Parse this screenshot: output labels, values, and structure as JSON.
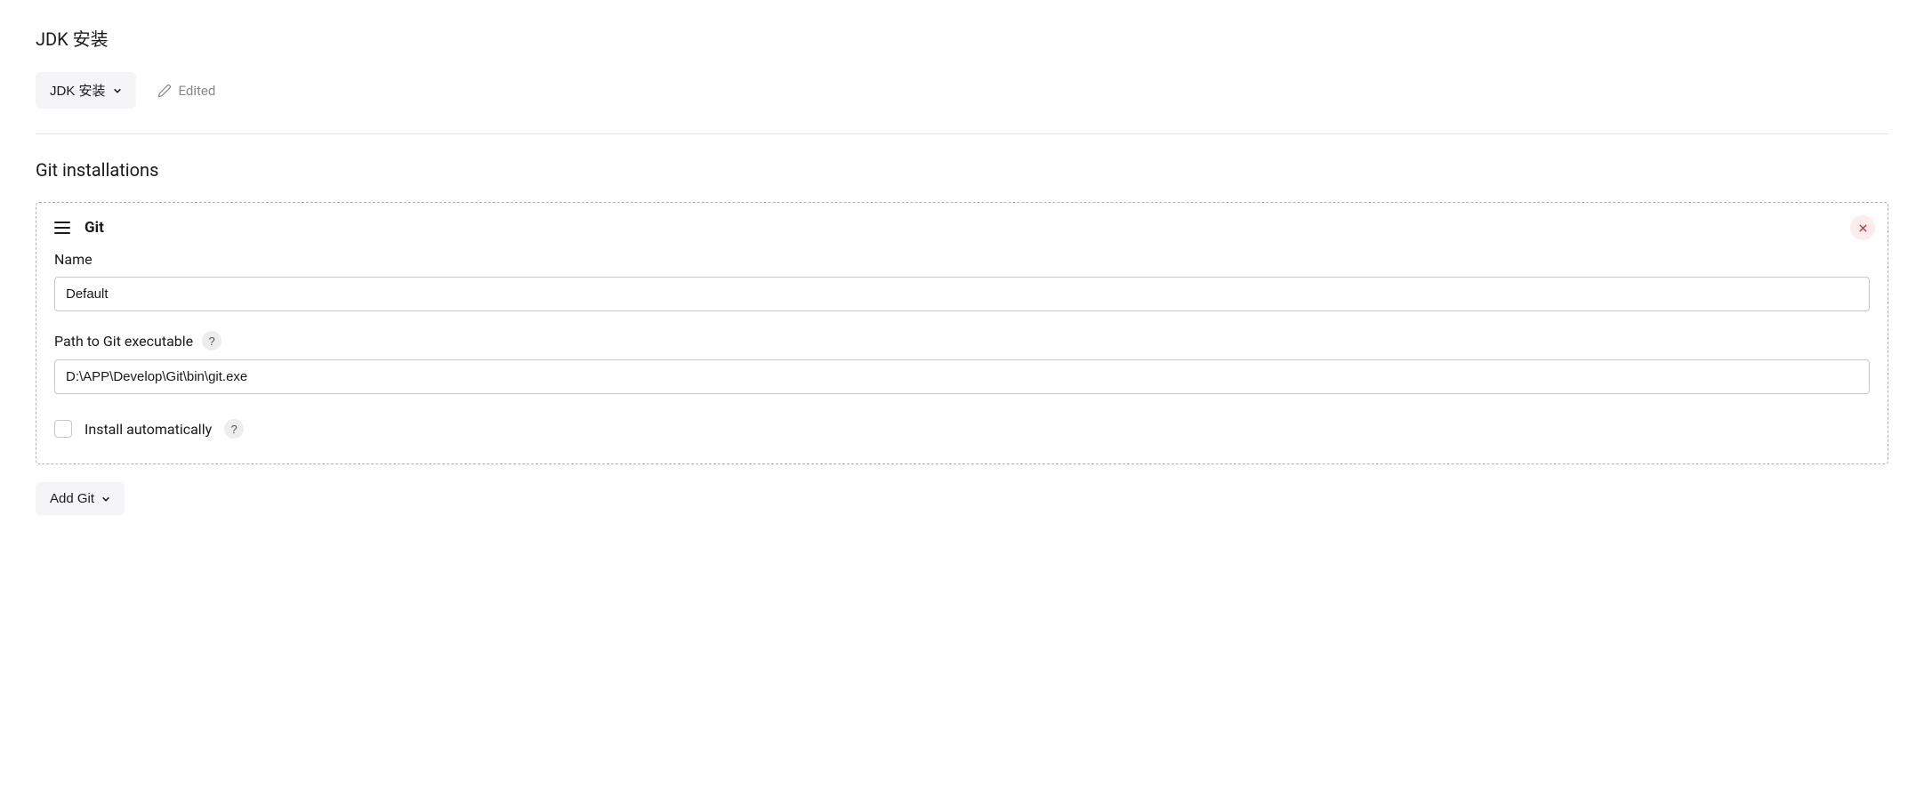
{
  "jdk_section": {
    "title": "JDK 安装",
    "dropdown_label": "JDK 安装",
    "edited_label": "Edited"
  },
  "git_section": {
    "title": "Git installations",
    "panel_title": "Git",
    "name_label": "Name",
    "name_value": "Default",
    "path_label": "Path to Git executable",
    "path_value": "D:\\APP\\Develop\\Git\\bin\\git.exe",
    "install_auto_label": "Install automatically",
    "install_auto_checked": false,
    "add_button_label": "Add Git"
  }
}
